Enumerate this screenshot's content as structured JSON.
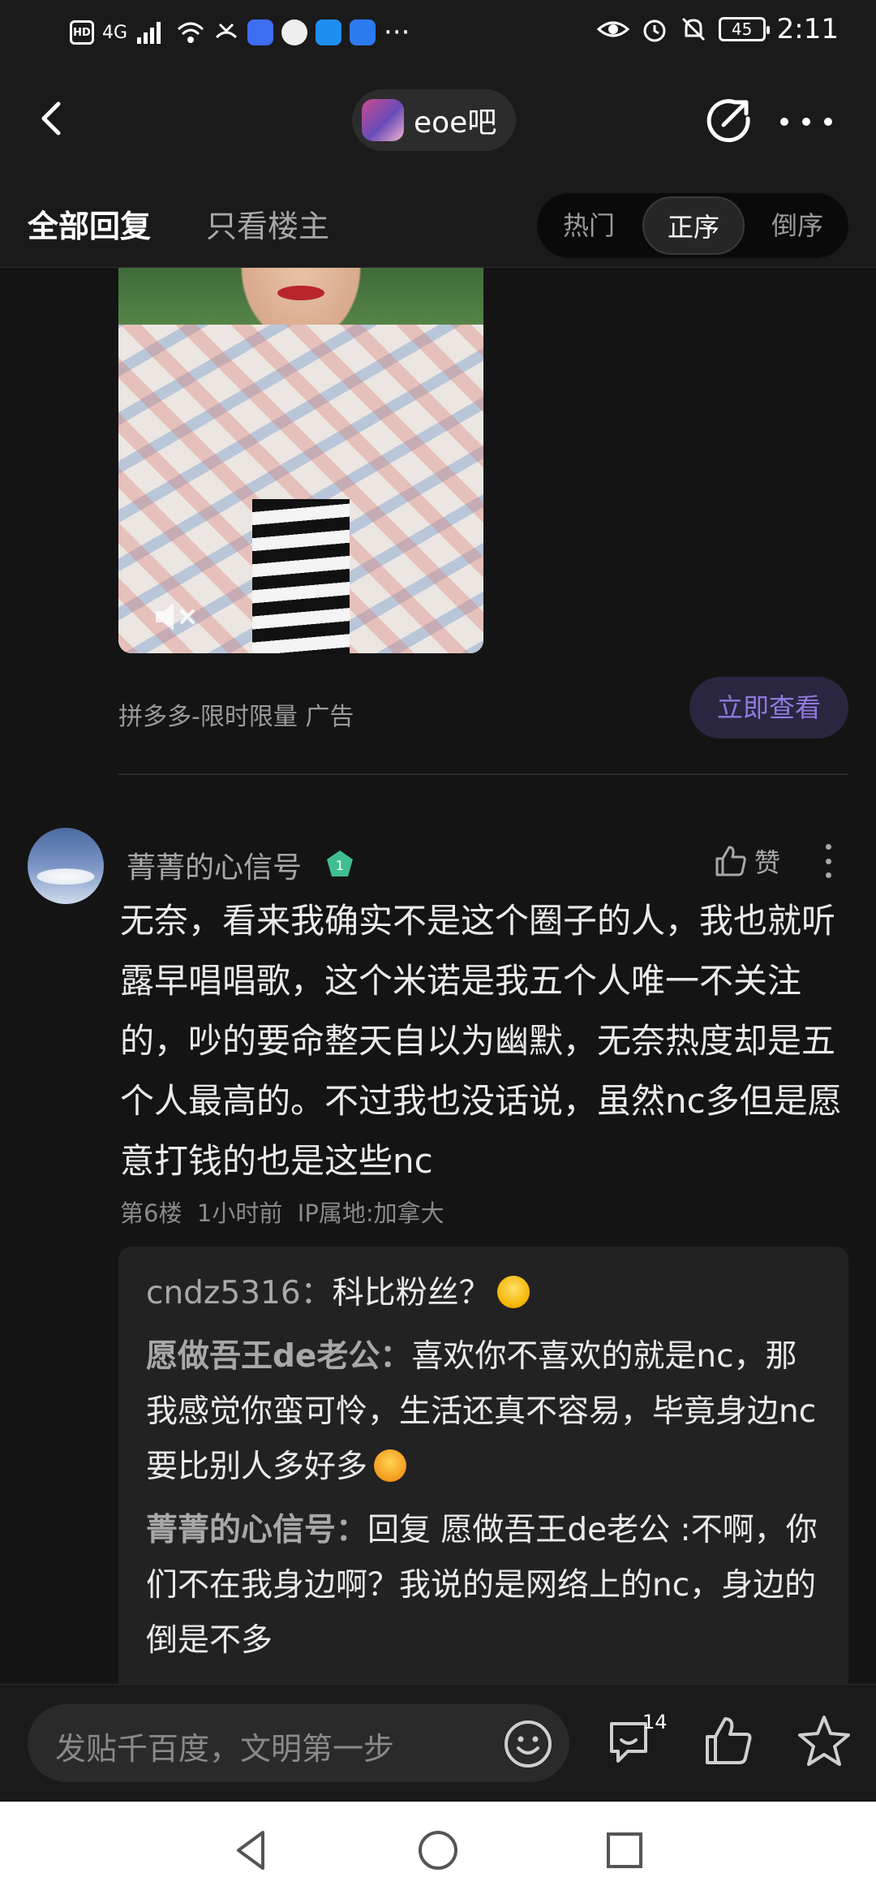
{
  "status_bar": {
    "left_badge": "HD",
    "network": "4G",
    "more": "···",
    "battery": "45",
    "time": "2:11"
  },
  "header": {
    "forum_name": "eoe吧"
  },
  "tabs": {
    "all_replies": "全部回复",
    "op_only": "只看楼主",
    "sort_options": [
      "热门",
      "正序",
      "倒序"
    ],
    "sort_selected": "正序"
  },
  "ad": {
    "source": "拼多多-限时限量  广告",
    "cta": "立即查看"
  },
  "post": {
    "username": "菁菁的心信号",
    "level": "1",
    "like_label": "赞",
    "body": "无奈，看来我确实不是这个圈子的人，我也就听露早唱唱歌，这个米诺是我五个人唯一不关注的，吵的要命整天自以为幽默，无奈热度却是五个人最高的。不过我也没话说，虽然nc多但是愿意打钱的也是这些nc",
    "meta": "第6楼  1小时前  IP属地:加拿大",
    "replies": [
      {
        "name": "cndz5316：",
        "text": "科比粉丝？",
        "emoji": "smile-emoji"
      },
      {
        "name": "愿做吾王de老公：",
        "text": "喜欢你不喜欢的就是nc，那我感觉你蛮可怜，生活还真不容易，毕竟身边nc要比别人多好多",
        "emoji": "angry-emoji"
      },
      {
        "name": "菁菁的心信号：",
        "text": "回复 愿做吾王de老公 :不啊，你们不在我身边啊？我说的是网络上的nc，身边的倒是不多",
        "emoji": ""
      }
    ]
  },
  "bottom_bar": {
    "input_placeholder": "发贴千百度，文明第一步",
    "comment_count": "14"
  },
  "colors": {
    "background": "#141414",
    "accent": "#8f7be0",
    "level_badge": "#3fbf8f"
  }
}
